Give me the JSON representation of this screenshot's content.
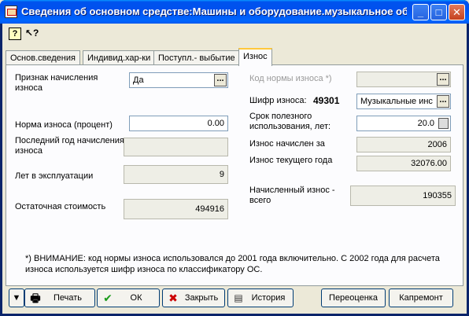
{
  "window": {
    "title": "Сведения об основном средстве:Машины и оборудование.музыкальное об...",
    "controls": [
      "_",
      "□",
      "✕"
    ]
  },
  "toolbar": {
    "help_icon": "?",
    "whats_this_icon": "↖?"
  },
  "tabs": [
    {
      "label": "Основ.сведения"
    },
    {
      "label": "Индивид.хар-ки"
    },
    {
      "label": "Поступл.- выбытие"
    },
    {
      "label": "Износ"
    }
  ],
  "active_tab": "Износ",
  "left": {
    "depreciation_flag_label": "Признак начисления износа",
    "depreciation_flag_value": "Да",
    "norm_label": "Норма износа (процент)",
    "norm_value": "0.00",
    "last_year_label": "Последний год начисления износа",
    "last_year_value": "",
    "years_label": "Лет в эксплуатации",
    "years_value": "9",
    "residual_label": "Остаточная стоимость",
    "residual_value": "494916"
  },
  "right": {
    "norm_code_label": "Код нормы износа *)",
    "norm_code_value": "",
    "cipher_label": "Шифр износа:",
    "cipher_code": "49301",
    "cipher_value": "Музыкальные инс",
    "useful_life_label": "Срок полезного использования, лет:",
    "useful_life_value": "20.0",
    "charged_for_label": "Износ начислен за",
    "charged_for_value": "2006",
    "current_year_label": "Износ текущего года",
    "current_year_value": "32076.00",
    "total_label": "Начисленный износ - всего",
    "total_value": "190355"
  },
  "note": "*) ВНИМАНИЕ: код нормы износа использовался до 2001 года включительно. С 2002 года для расчета износа используется шифр износа по классификатору ОС.",
  "buttons": {
    "menu_arrow": "▼",
    "print": "Печать",
    "ok": "ОК",
    "close": "Закрыть",
    "history": "История",
    "revaluation": "Переоценка",
    "repair": "Капремонт"
  },
  "icons": {
    "printer": "printer-icon",
    "ok": "checkmark-icon",
    "close": "red-x-icon",
    "history": "history-icon"
  }
}
